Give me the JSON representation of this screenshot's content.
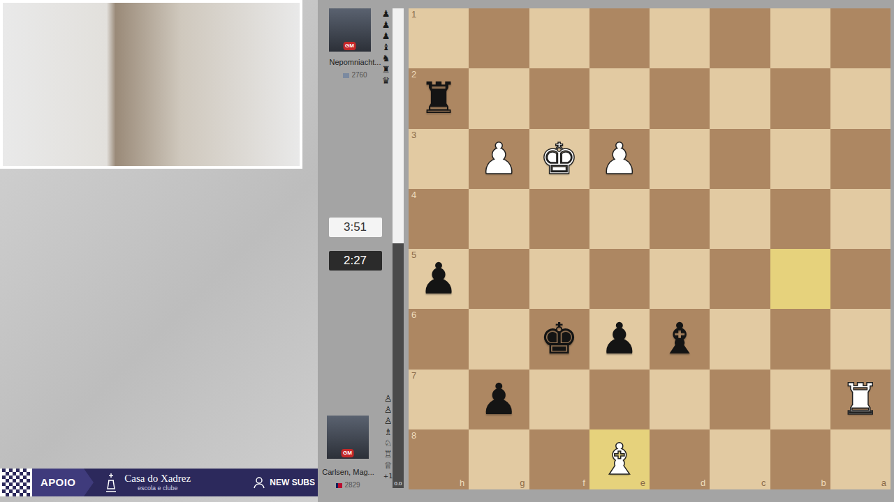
{
  "banner": {
    "support_label": "APOIO",
    "brand_name": "Casa do Xadrez",
    "brand_tagline": "escola e clube",
    "subs_label": "NEW SUBS"
  },
  "players": [
    {
      "position": "top",
      "name": "Nepomniacht...",
      "title": "GM",
      "rating": "2760",
      "captured": [
        "♟",
        "♟",
        "♟",
        "♝",
        "♞",
        "♜",
        "♛"
      ]
    },
    {
      "position": "bottom",
      "name": "Carlsen, Mag...",
      "title": "GM",
      "rating": "2829",
      "captured": [
        "♙",
        "♙",
        "♙",
        "♗",
        "♘",
        "♖",
        "♕"
      ],
      "advantage": "+1"
    }
  ],
  "clocks": [
    {
      "time": "3:51",
      "active": false
    },
    {
      "time": "2:27",
      "active": true
    }
  ],
  "eval_bar": {
    "level": 0.49,
    "reading": "0.0"
  },
  "board": {
    "ranks": [
      "1",
      "2",
      "3",
      "4",
      "5",
      "6",
      "7",
      "8"
    ],
    "files": [
      "h",
      "g",
      "f",
      "e",
      "d",
      "c",
      "b",
      "a"
    ],
    "highlighted": [
      "b5",
      "e8"
    ],
    "pieces": [
      {
        "square": "h2",
        "glyph": "♜",
        "color": "black"
      },
      {
        "square": "g3",
        "glyph": "♟",
        "color": "white"
      },
      {
        "square": "f3",
        "glyph": "♚",
        "color": "white"
      },
      {
        "square": "e3",
        "glyph": "♟",
        "color": "white"
      },
      {
        "square": "h5",
        "glyph": "♟",
        "color": "black"
      },
      {
        "square": "f6",
        "glyph": "♚",
        "color": "black"
      },
      {
        "square": "e6",
        "glyph": "♟",
        "color": "black"
      },
      {
        "square": "d6",
        "glyph": "♝",
        "color": "black"
      },
      {
        "square": "g7",
        "glyph": "♟",
        "color": "black"
      },
      {
        "square": "a7",
        "glyph": "♜",
        "color": "white"
      },
      {
        "square": "e8",
        "glyph": "♝",
        "color": "white"
      }
    ]
  }
}
